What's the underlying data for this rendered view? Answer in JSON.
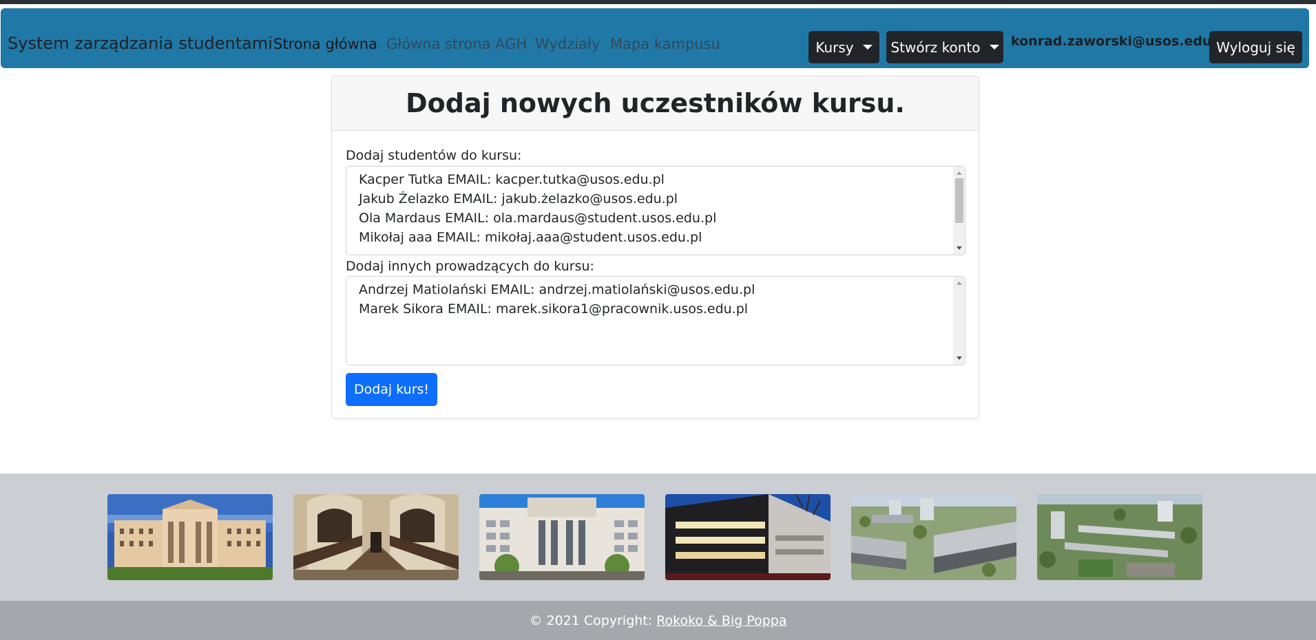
{
  "navbar": {
    "brand": "System zarządzania studentami",
    "links": [
      "Strona główna",
      "Główna strona AGH",
      "Wydziały",
      "Mapa kampusu"
    ],
    "courses_dropdown": "Kursy",
    "account_dropdown": "Stwórz konto",
    "user_email": "konrad.zaworski@usos.edu.pl",
    "logout": "Wyloguj się"
  },
  "form": {
    "heading": "Dodaj nowych uczestników kursu.",
    "students_label": "Dodaj studentów do kursu:",
    "students": [
      "Kacper Tutka EMAIL: kacper.tutka@usos.edu.pl",
      "Jakub Żelazko EMAIL: jakub.żelazko@usos.edu.pl",
      "Ola Mardaus EMAIL: ola.mardaus@student.usos.edu.pl",
      "Mikołaj aaa EMAIL: mikołaj.aaa@student.usos.edu.pl"
    ],
    "teachers_label": "Dodaj innych prowadzących do kursu:",
    "teachers": [
      "Andrzej Matiolański EMAIL: andrzej.matiolański@usos.edu.pl",
      "Marek Sikora EMAIL: marek.sikora1@pracownik.usos.edu.pl"
    ],
    "submit": "Dodaj kurs!"
  },
  "footer": {
    "copyright": "© 2021 Copyright:",
    "link": "Rokoko & Big Poppa"
  },
  "colors": {
    "navbar": "#2078a6",
    "dark_button": "#212529",
    "primary_button": "#0d6efd",
    "gallery_bg": "#cbcfd3",
    "footer_bg": "#a4a8ac"
  }
}
